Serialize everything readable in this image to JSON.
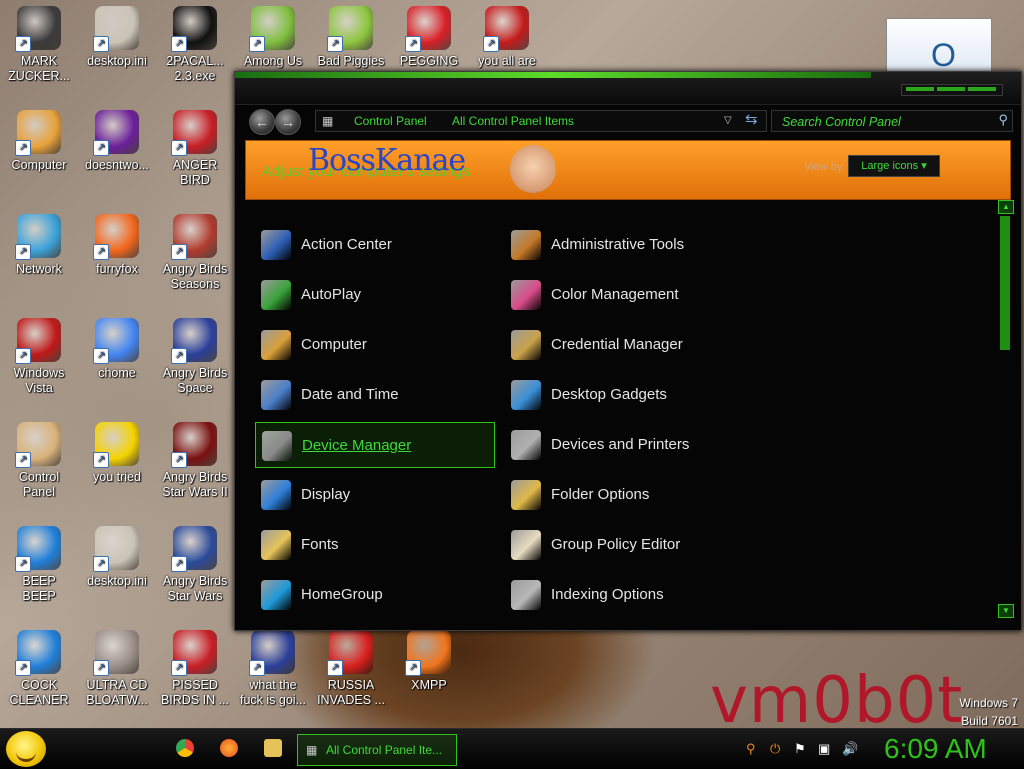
{
  "desktop": {
    "icons": [
      {
        "label": "MARK\nZUCKER...",
        "icon": "zuckerberg-icon",
        "color": "#3b3b3b"
      },
      {
        "label": "desktop.ini",
        "icon": "settings-file-icon",
        "color": "#c9c4b6"
      },
      {
        "label": "2PACAL...\n2.3.exe",
        "icon": "console-icon",
        "color": "#111111"
      },
      {
        "label": "Among Us",
        "icon": "among-us-icon",
        "color": "#7fbf3f"
      },
      {
        "label": "Bad Piggies",
        "icon": "bad-piggies-icon",
        "color": "#8dc63f"
      },
      {
        "label": "PEGGING",
        "icon": "pegging-icon",
        "color": "#d91f26"
      },
      {
        "label": "you all are",
        "icon": "devcpp-icon",
        "color": "#c41a1a"
      },
      {
        "label": "Computer",
        "icon": "computer-icon",
        "color": "#e8a23a"
      },
      {
        "label": "doesntwo...",
        "icon": "yahoo-icon",
        "color": "#6b1f9a"
      },
      {
        "label": "ANGER\nBIRD",
        "icon": "angry-bird-icon",
        "color": "#c81d25"
      },
      {
        "label": "Network",
        "icon": "network-icon",
        "color": "#3aa3d9"
      },
      {
        "label": "furryfox",
        "icon": "firefox-icon",
        "color": "#f2661c"
      },
      {
        "label": "Angry Birds\nSeasons",
        "icon": "angry-birds-seasons-icon",
        "color": "#b03a2e"
      },
      {
        "label": "Windows\nVista",
        "icon": "recycle-bin-icon",
        "color": "#c01818"
      },
      {
        "label": "chome",
        "icon": "chrome-icon",
        "color": "#4285f4"
      },
      {
        "label": "Angry Birds\nSpace",
        "icon": "angry-birds-space-icon",
        "color": "#2a3f9a"
      },
      {
        "label": "Control\nPanel",
        "icon": "control-panel-icon",
        "color": "#d9b27a"
      },
      {
        "label": "you tried",
        "icon": "gold-star-icon",
        "color": "#f5d300"
      },
      {
        "label": "Angry Birds\nStar Wars II",
        "icon": "angry-birds-star-wars-ii-icon",
        "color": "#7a1010"
      },
      {
        "label": "BEEP\nBEEP",
        "icon": "blue-file-icon",
        "color": "#1f7fd9"
      },
      {
        "label": "desktop.ini",
        "icon": "settings-file-icon",
        "color": "#c9c4b6"
      },
      {
        "label": "Angry Birds\nStar Wars",
        "icon": "angry-birds-star-wars-icon",
        "color": "#2a4a9a"
      },
      {
        "label": "COCK\nCLEANER",
        "icon": "blue-file-icon",
        "color": "#1f7fd9"
      },
      {
        "label": "ULTRA CD\nBLOATW...",
        "icon": "cd-icon",
        "color": "#9a8f88"
      },
      {
        "label": "PISSED\nBIRDS IN ...",
        "icon": "angry-bird-icon",
        "color": "#c81d25"
      },
      {
        "label": "what the\nfuck is goi...",
        "icon": "angry-birds-space-icon",
        "color": "#2a3f9a"
      },
      {
        "label": "RUSSIA\nINVADES ...",
        "icon": "radiation-icon",
        "color": "#d92020"
      },
      {
        "label": "XMPP",
        "icon": "xampp-icon",
        "color": "#f0751e"
      }
    ],
    "watermark": "vm0b0t",
    "os_line1": "Windows 7",
    "os_line2": "Build 7601"
  },
  "window": {
    "breadcrumb": [
      "Control Panel",
      "All Control Panel Items"
    ],
    "search_placeholder": "Search Control Panel",
    "banner_logo": "BossKanae",
    "banner_heading": "Adjust your computer's settings",
    "view_by_label": "View by:",
    "view_by_value": "Large icons ▾",
    "items": [
      {
        "label": "Action Center",
        "icon": "action-center-flag-icon",
        "color": "#2d5fb5"
      },
      {
        "label": "Administrative Tools",
        "icon": "administrative-tools-icon",
        "color": "#c57a2a"
      },
      {
        "label": "AutoPlay",
        "icon": "autoplay-icon",
        "color": "#3aa33a"
      },
      {
        "label": "Color Management",
        "icon": "color-management-icon",
        "color": "#d94c8a"
      },
      {
        "label": "Computer",
        "icon": "computer-icon",
        "color": "#d9a03a"
      },
      {
        "label": "Credential Manager",
        "icon": "credential-manager-icon",
        "color": "#c9a24a"
      },
      {
        "label": "Date and Time",
        "icon": "date-time-icon",
        "color": "#4a7fc9"
      },
      {
        "label": "Desktop Gadgets",
        "icon": "desktop-gadgets-icon",
        "color": "#3a8fd9"
      },
      {
        "label": "Device Manager",
        "icon": "device-manager-icon",
        "color": "#8a8a8a"
      },
      {
        "label": "Devices and Printers",
        "icon": "devices-printers-icon",
        "color": "#b0b0b0"
      },
      {
        "label": "Display",
        "icon": "display-icon",
        "color": "#2f7fd9"
      },
      {
        "label": "Folder Options",
        "icon": "folder-options-icon",
        "color": "#e0b84a"
      },
      {
        "label": "Fonts",
        "icon": "fonts-icon",
        "color": "#e6c35a"
      },
      {
        "label": "Group Policy Editor",
        "icon": "group-policy-icon",
        "color": "#e8dcc0"
      },
      {
        "label": "HomeGroup",
        "icon": "homegroup-icon",
        "color": "#1f9ad9"
      },
      {
        "label": "Indexing Options",
        "icon": "indexing-options-icon",
        "color": "#b8b8b8"
      }
    ],
    "selected_label": "Device Manager"
  },
  "taskbar": {
    "task_label": "All Control Panel Ite...",
    "clock": "6:09 AM",
    "accent_color": "#2ec21a"
  }
}
